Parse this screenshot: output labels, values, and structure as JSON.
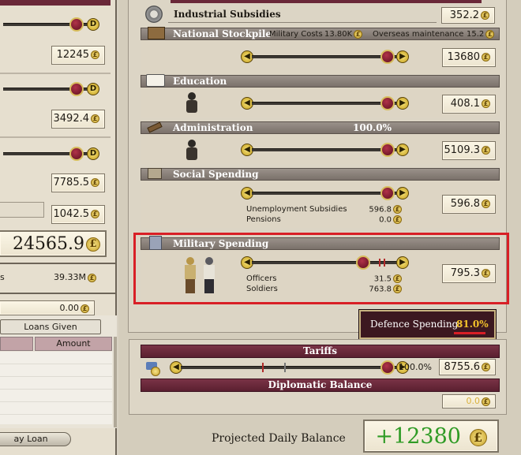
{
  "left_panel": {
    "values": [
      "12245",
      "3492.4",
      "7785.5",
      "1042.5"
    ],
    "total": "24565.9",
    "income_label": "s",
    "income_value": "39.33M",
    "loan_value": "0.00",
    "tab_loans_given": "Loans Given",
    "col_amount": "Amount",
    "pay_loan_button": "ay Loan"
  },
  "currency_symbol": "£",
  "industrial_subsidies": {
    "label": "Industrial Subsidies",
    "value": "352.2"
  },
  "national_stockpile": {
    "label": "National Stockpile",
    "military_costs_label": "Military Costs",
    "military_costs_value": "13.80K",
    "overseas_label": "Overseas maintenance",
    "overseas_value": "15.2",
    "value": "13680"
  },
  "education": {
    "label": "Education",
    "value": "408.1"
  },
  "administration": {
    "label": "Administration",
    "percent": "100.0%",
    "value": "5109.3"
  },
  "social_spending": {
    "label": "Social Spending",
    "value": "596.8",
    "rows": [
      {
        "label": "Unemployment Subsidies",
        "value": "596.8"
      },
      {
        "label": "Pensions",
        "value": "0.0"
      }
    ]
  },
  "military_spending": {
    "label": "Military Spending",
    "value": "795.3",
    "rows": [
      {
        "label": "Officers",
        "value": "31.5"
      },
      {
        "label": "Soldiers",
        "value": "763.8"
      }
    ]
  },
  "defence_spending": {
    "label": "Defence Spending:",
    "value": "81.0%"
  },
  "tariffs": {
    "label": "Tariffs",
    "percent": "100.0%",
    "value": "8755.6"
  },
  "diplomatic_balance": {
    "label": "Diplomatic Balance",
    "value": "0.0"
  },
  "projected_daily_balance": {
    "label": "Projected Daily Balance",
    "value": "+12380"
  },
  "colors": {
    "highlight_red": "#d81f26",
    "positive_green": "#2f9b25",
    "defence_value": "#f3c22a",
    "header_maroon": "#6a2839"
  }
}
